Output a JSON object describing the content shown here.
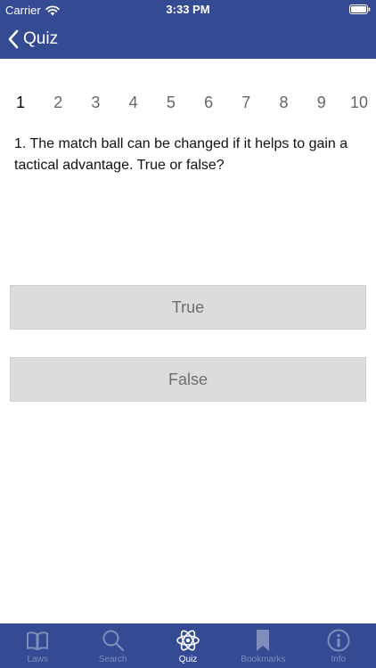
{
  "status_bar": {
    "carrier": "Carrier",
    "time": "3:33 PM"
  },
  "nav": {
    "back_label": "Quiz"
  },
  "pager": {
    "pages": [
      "1",
      "2",
      "3",
      "4",
      "5",
      "6",
      "7",
      "8",
      "9",
      "10"
    ],
    "active_index": 0
  },
  "question": {
    "text": "1. The match ball can be changed if it helps to gain a tactical advantage. True or false?"
  },
  "answers": {
    "true_label": "True",
    "false_label": "False"
  },
  "tabs": [
    {
      "label": "Laws",
      "icon": "book-icon"
    },
    {
      "label": "Search",
      "icon": "search-icon"
    },
    {
      "label": "Quiz",
      "icon": "atom-icon"
    },
    {
      "label": "Bookmarks",
      "icon": "bookmark-icon"
    },
    {
      "label": "Info",
      "icon": "info-icon"
    }
  ],
  "active_tab": "Quiz",
  "colors": {
    "header_bg": "#344a93",
    "tab_inactive": "#7f8dbd",
    "tab_active": "#ffffff",
    "button_bg": "#dcdcdc",
    "button_text": "#6e6e6e"
  }
}
